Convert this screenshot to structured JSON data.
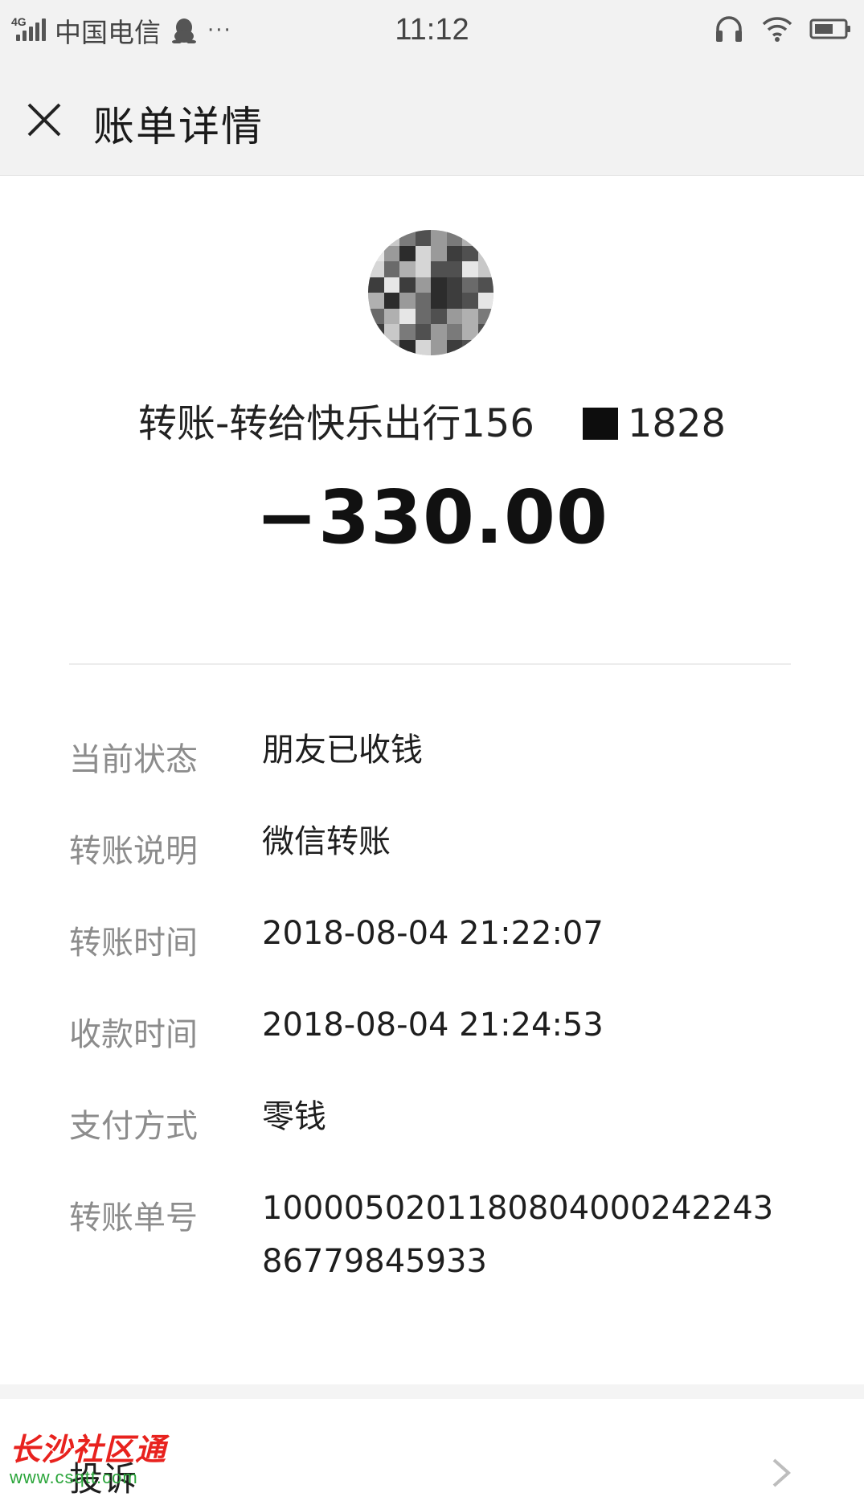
{
  "status_bar": {
    "network": "4G",
    "carrier": "中国电信",
    "more": "···",
    "time": "11:12"
  },
  "header": {
    "close_icon": "close-icon",
    "title": "账单详情"
  },
  "bill": {
    "avatar": "pixelated-avatar",
    "title_prefix": "转账-转给快乐出行156",
    "title_suffix": "1828",
    "amount": "−330.00"
  },
  "details": [
    {
      "label": "当前状态",
      "value": "朋友已收钱"
    },
    {
      "label": "转账说明",
      "value": "微信转账"
    },
    {
      "label": "转账时间",
      "value": "2018-08-04 21:22:07"
    },
    {
      "label": "收款时间",
      "value": "2018-08-04 21:24:53"
    },
    {
      "label": "支付方式",
      "value": "零钱"
    },
    {
      "label": "转账单号",
      "value": "100005020118080400024224386779845933"
    }
  ],
  "complaint": {
    "label": "投诉",
    "icon": "chevron-right-icon"
  },
  "watermark": {
    "title": "长沙社区通",
    "url": "www.csqtt.com"
  },
  "colors": {
    "header_bg": "#f2f2f2",
    "label_gray": "#8c8c8c",
    "watermark_red": "#e8221e",
    "watermark_green": "#2aa53a"
  }
}
